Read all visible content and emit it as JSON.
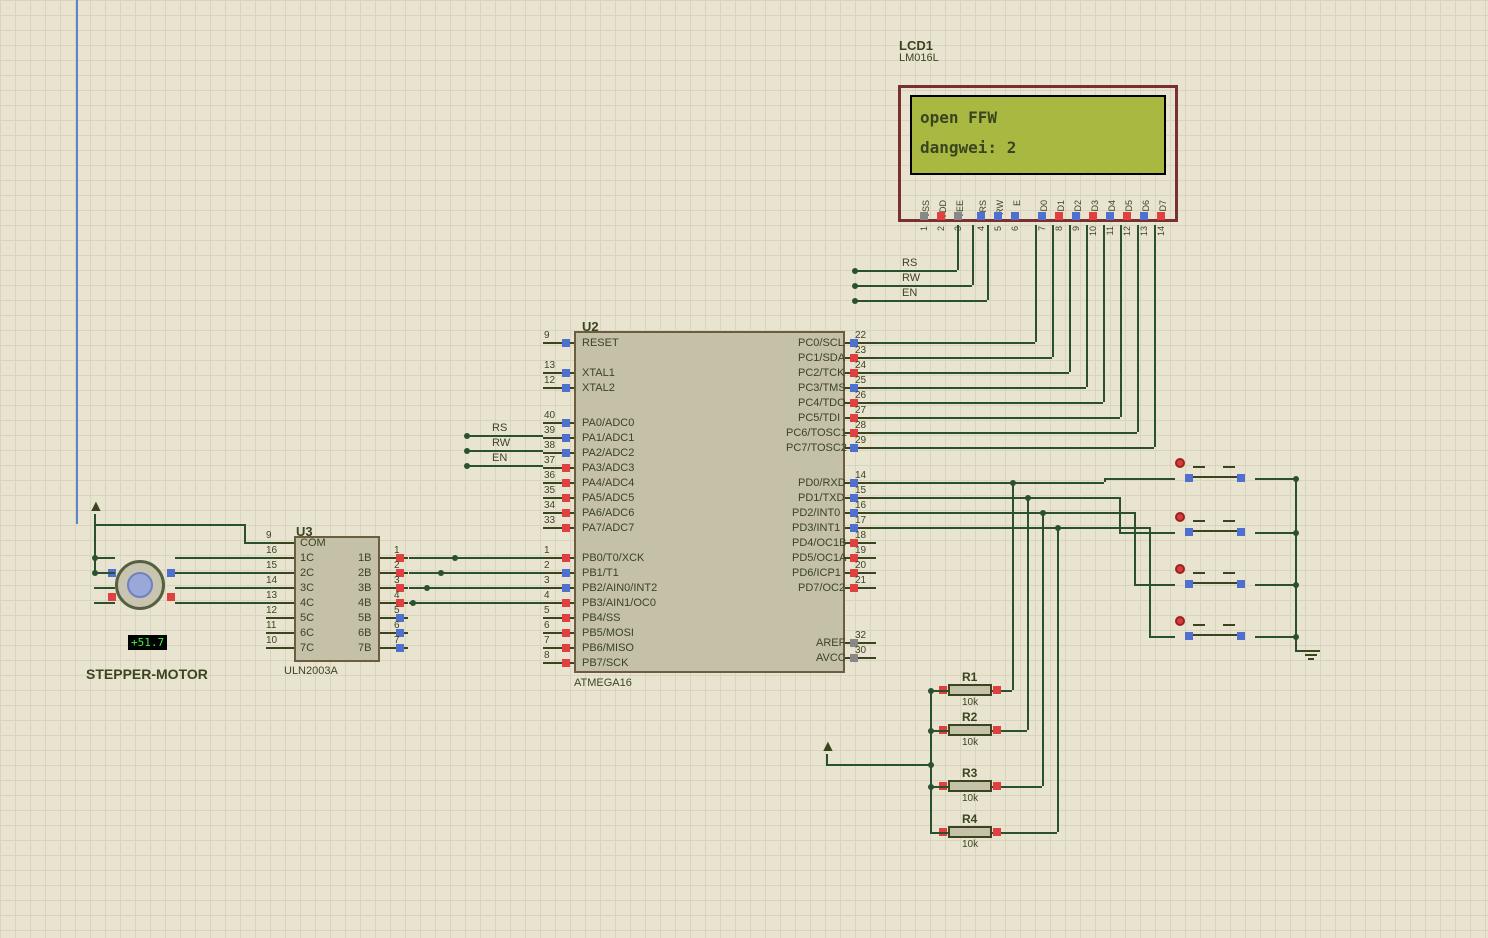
{
  "lcd": {
    "ref": "LCD1",
    "part": "LM016L",
    "line1": "open   FFW",
    "line2": "dangwei: 2",
    "pins": [
      "VSS",
      "VDD",
      "VEE",
      "RS",
      "RW",
      "E",
      "D0",
      "D1",
      "D2",
      "D3",
      "D4",
      "D5",
      "D6",
      "D7"
    ],
    "pin_nums": [
      "1",
      "2",
      "3",
      "4",
      "5",
      "6",
      "7",
      "8",
      "9",
      "10",
      "11",
      "12",
      "13",
      "14"
    ]
  },
  "mcu": {
    "ref": "U2",
    "part": "ATMEGA16",
    "left_pins": [
      {
        "num": "9",
        "name": "RESET"
      },
      {
        "num": "13",
        "name": "XTAL1"
      },
      {
        "num": "12",
        "name": "XTAL2"
      },
      {
        "num": "40",
        "name": "PA0/ADC0"
      },
      {
        "num": "39",
        "name": "PA1/ADC1"
      },
      {
        "num": "38",
        "name": "PA2/ADC2"
      },
      {
        "num": "37",
        "name": "PA3/ADC3"
      },
      {
        "num": "36",
        "name": "PA4/ADC4"
      },
      {
        "num": "35",
        "name": "PA5/ADC5"
      },
      {
        "num": "34",
        "name": "PA6/ADC6"
      },
      {
        "num": "33",
        "name": "PA7/ADC7"
      },
      {
        "num": "1",
        "name": "PB0/T0/XCK"
      },
      {
        "num": "2",
        "name": "PB1/T1"
      },
      {
        "num": "3",
        "name": "PB2/AIN0/INT2"
      },
      {
        "num": "4",
        "name": "PB3/AIN1/OC0"
      },
      {
        "num": "5",
        "name": "PB4/SS",
        "overline": "SS"
      },
      {
        "num": "6",
        "name": "PB5/MOSI"
      },
      {
        "num": "7",
        "name": "PB6/MISO"
      },
      {
        "num": "8",
        "name": "PB7/SCK"
      }
    ],
    "right_pins": [
      {
        "num": "22",
        "name": "PC0/SCL"
      },
      {
        "num": "23",
        "name": "PC1/SDA"
      },
      {
        "num": "24",
        "name": "PC2/TCK"
      },
      {
        "num": "25",
        "name": "PC3/TMS"
      },
      {
        "num": "26",
        "name": "PC4/TDO"
      },
      {
        "num": "27",
        "name": "PC5/TDI"
      },
      {
        "num": "28",
        "name": "PC6/TOSC1"
      },
      {
        "num": "29",
        "name": "PC7/TOSC2"
      },
      {
        "num": "14",
        "name": "PD0/RXD"
      },
      {
        "num": "15",
        "name": "PD1/TXD"
      },
      {
        "num": "16",
        "name": "PD2/INT0"
      },
      {
        "num": "17",
        "name": "PD3/INT1"
      },
      {
        "num": "18",
        "name": "PD4/OC1B"
      },
      {
        "num": "19",
        "name": "PD5/OC1A"
      },
      {
        "num": "20",
        "name": "PD6/ICP1"
      },
      {
        "num": "21",
        "name": "PD7/OC2"
      },
      {
        "num": "32",
        "name": "AREF"
      },
      {
        "num": "30",
        "name": "AVCC"
      }
    ]
  },
  "driver": {
    "ref": "U3",
    "part": "ULN2003A",
    "left_pins": [
      {
        "num": "9",
        "name": "COM"
      },
      {
        "num": "16",
        "name": "1C"
      },
      {
        "num": "15",
        "name": "2C"
      },
      {
        "num": "14",
        "name": "3C"
      },
      {
        "num": "13",
        "name": "4C"
      },
      {
        "num": "12",
        "name": "5C"
      },
      {
        "num": "11",
        "name": "6C"
      },
      {
        "num": "10",
        "name": "7C"
      }
    ],
    "right_pins": [
      {
        "num": "",
        "name": ""
      },
      {
        "num": "1",
        "name": "1B"
      },
      {
        "num": "2",
        "name": "2B"
      },
      {
        "num": "3",
        "name": "3B"
      },
      {
        "num": "4",
        "name": "4B"
      },
      {
        "num": "5",
        "name": "5B"
      },
      {
        "num": "6",
        "name": "6B"
      },
      {
        "num": "7",
        "name": "7B"
      }
    ]
  },
  "motor": {
    "label": "STEPPER-MOTOR",
    "value": "+51.7"
  },
  "resistors": [
    {
      "ref": "R1",
      "value": "10k"
    },
    {
      "ref": "R2",
      "value": "10k"
    },
    {
      "ref": "R3",
      "value": "10k"
    },
    {
      "ref": "R4",
      "value": "10k"
    }
  ],
  "nets": {
    "rs": "RS",
    "rw": "RW",
    "en": "EN"
  }
}
